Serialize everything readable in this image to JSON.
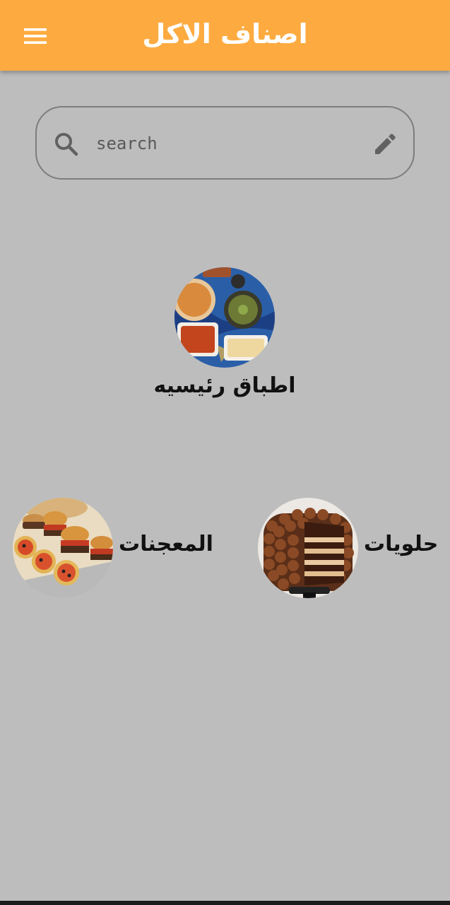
{
  "app_bar": {
    "title": "اصناف الاكل",
    "menu_icon": "hamburger-menu-icon",
    "background": "#fdab40"
  },
  "search": {
    "placeholder": "search",
    "value": "",
    "leading_icon": "search-icon",
    "trailing_icon": "edit-pencil-icon"
  },
  "categories": [
    {
      "label": "اطباق رئيسيه",
      "image": "main-dishes-image"
    },
    {
      "label": "المعجنات",
      "image": "pastries-image"
    },
    {
      "label": "حلويات",
      "image": "desserts-image"
    }
  ],
  "colors": {
    "background": "#bdbdbd",
    "accent": "#fdab40"
  }
}
